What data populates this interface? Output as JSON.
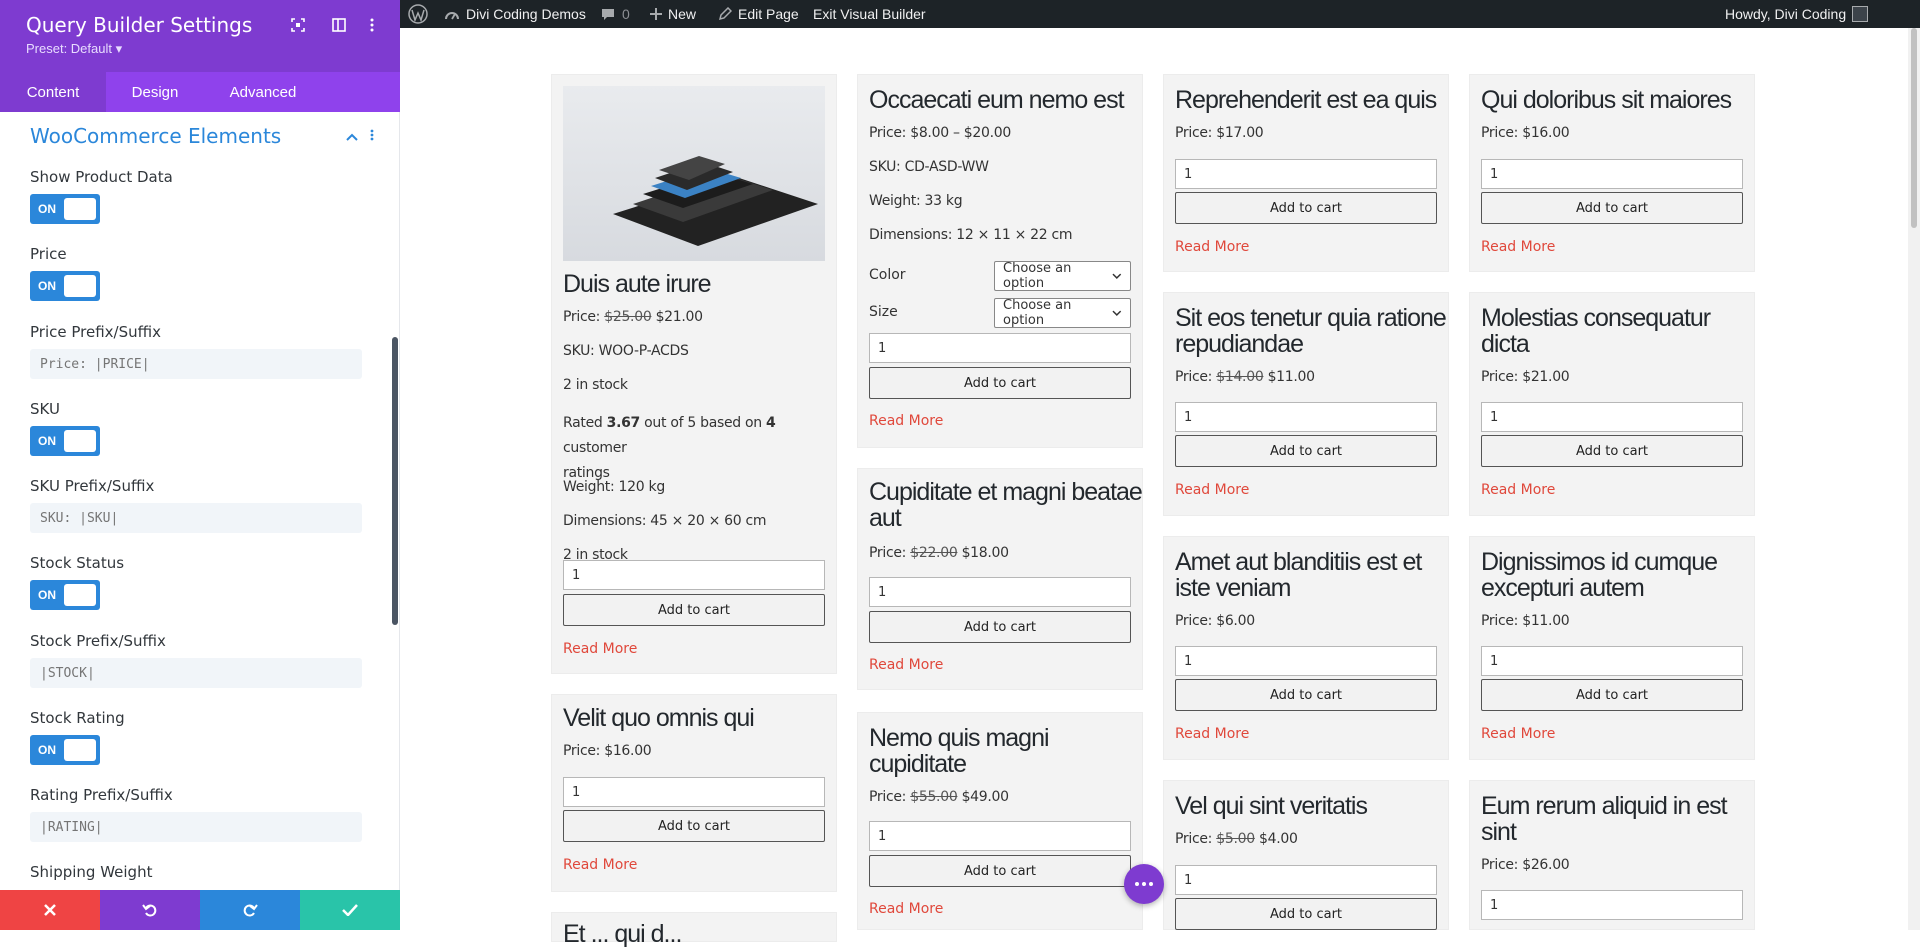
{
  "panel": {
    "title": "Query Builder Settings",
    "preset": "Preset: Default ▾",
    "tabs": [
      "Content",
      "Design",
      "Advanced"
    ],
    "section_title": "WooCommerce Elements",
    "toggle_label": "ON",
    "fields": {
      "show_product_data": "Show Product Data",
      "price": "Price",
      "price_prefix": "Price Prefix/Suffix",
      "price_prefix_value": "Price: |PRICE|",
      "sku": "SKU",
      "sku_prefix": "SKU Prefix/Suffix",
      "sku_prefix_value": "SKU: |SKU|",
      "stock_status": "Stock Status",
      "stock_prefix": "Stock Prefix/Suffix",
      "stock_prefix_value": "|STOCK|",
      "stock_rating": "Stock Rating",
      "rating_prefix": "Rating Prefix/Suffix",
      "rating_prefix_value": "|RATING|",
      "shipping_weight": "Shipping Weight"
    },
    "bottom_colors": {
      "close": "#ef4444",
      "undo": "#7e3bd0",
      "redo": "#2b87da",
      "save": "#29c4a9"
    }
  },
  "adminbar": {
    "site_name": "Divi Coding Demos",
    "comments": "0",
    "new": "New",
    "edit_page": "Edit Page",
    "exit_vb": "Exit Visual Builder",
    "howdy": "Howdy, Divi Coding"
  },
  "common": {
    "add_to_cart": "Add to cart",
    "read_more": "Read More",
    "qty": "1",
    "choose_option": "Choose an option"
  },
  "products": {
    "p1": {
      "title": "Duis aute irure",
      "price_label": "Price:",
      "old": "$25.00",
      "new": "$21.00",
      "sku": "SKU: WOO-P-ACDS",
      "stock": "2 in stock",
      "rating_pre": "Rated",
      "rating_val": "3.67",
      "rating_post": "out of 5 based on",
      "rating_count": "4",
      "rating_tail": "customer",
      "rating_tail2": "ratings",
      "weight": "Weight: 120 kg",
      "dims": "Dimensions: 45 × 20 × 60 cm",
      "stock2": "2 in stock"
    },
    "p2": {
      "title": "Velit quo omnis qui",
      "price": "Price: $16.00"
    },
    "p3": {
      "title": "Occaecati eum nemo est",
      "price": "Price: $8.00 – $20.00",
      "sku": "SKU: CD-ASD-WW",
      "weight": "Weight: 33 kg",
      "dims": "Dimensions: 12 × 11 × 22 cm",
      "color": "Color",
      "size": "Size"
    },
    "p4": {
      "title1": "Cupiditate et magni beatae",
      "title2": "aut",
      "price_label": "Price:",
      "old": "$22.00",
      "new": "$18.00"
    },
    "p5": {
      "title1": "Nemo quis magni",
      "title2": "cupiditate",
      "price_label": "Price:",
      "old": "$55.00",
      "new": "$49.00"
    },
    "p6": {
      "title": "Reprehenderit est ea quis",
      "price": "Price: $17.00"
    },
    "p7": {
      "title1": "Sit eos tenetur quia ratione",
      "title2": "repudiandae",
      "price_label": "Price:",
      "old": "$14.00",
      "new": "$11.00"
    },
    "p8": {
      "title1": "Amet aut blanditiis est et",
      "title2": "iste veniam",
      "price": "Price: $6.00"
    },
    "p9": {
      "title": "Vel qui sint veritatis",
      "price_label": "Price:",
      "old": "$5.00",
      "new": "$4.00"
    },
    "p10": {
      "title": "Qui doloribus sit maiores",
      "price": "Price: $16.00"
    },
    "p11": {
      "title1": "Molestias consequatur",
      "title2": "dicta",
      "price": "Price: $21.00"
    },
    "p12": {
      "title1": "Dignissimos id cumque",
      "title2": "excepturi autem",
      "price": "Price: $11.00"
    },
    "p13": {
      "title1": "Eum rerum aliquid in est",
      "title2": "sint",
      "price": "Price: $26.00"
    },
    "p14": {
      "title": "Et ... qui d..."
    }
  }
}
